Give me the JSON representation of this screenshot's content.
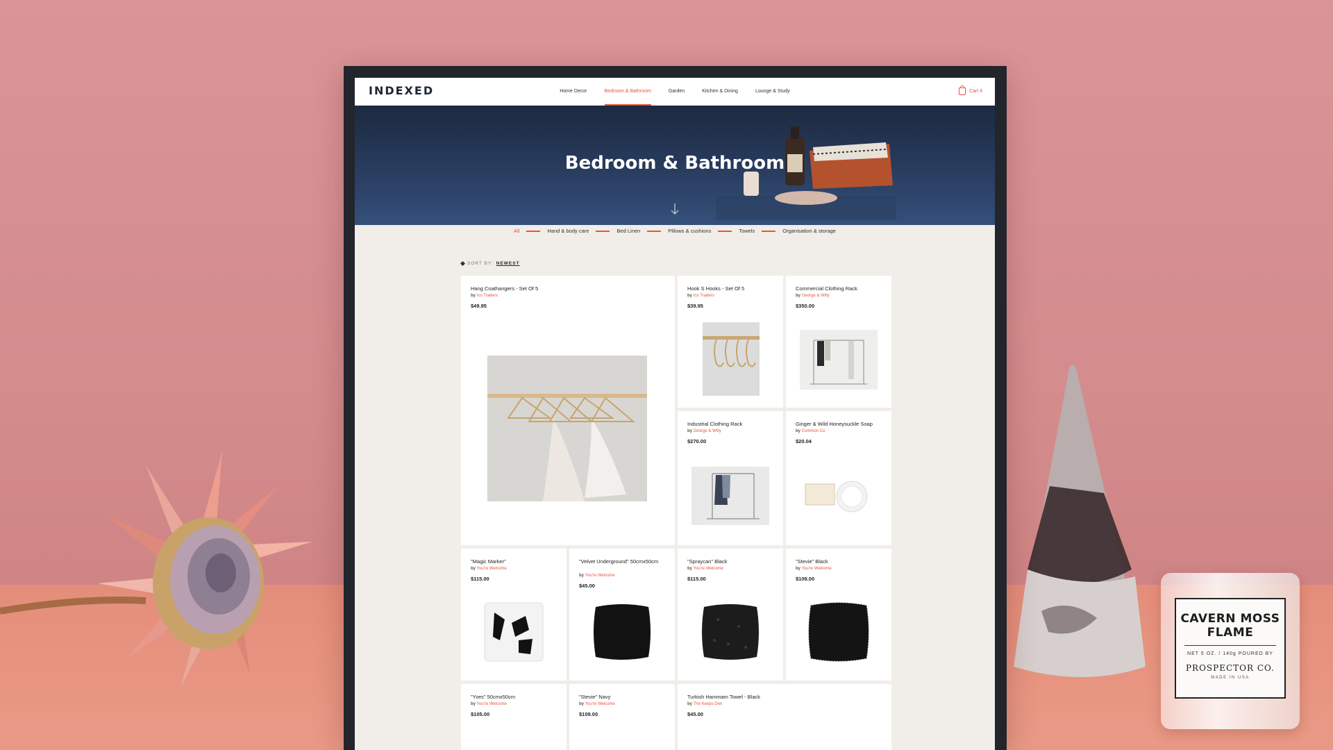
{
  "site": {
    "logo": "INDEXED",
    "nav": [
      "Home Decor",
      "Bedroom & Bathroom",
      "Garden",
      "Kitchen & Dining",
      "Lounge & Study"
    ],
    "active_nav": "Bedroom & Bathroom",
    "cart_label": "Cart 4"
  },
  "hero": {
    "title": "Bedroom & Bathroom"
  },
  "filters": [
    "All",
    "Hand & body care",
    "Bed Linen",
    "Pillows & cushions",
    "Towels",
    "Organisation & storage"
  ],
  "active_filter": "All",
  "sort": {
    "label": "SORT BY:",
    "value": "NEWEST"
  },
  "products": [
    {
      "name": "Hang Coathangers - Set Of 5",
      "by_prefix": "by",
      "brand": "Ico Traders",
      "price": "$49.95"
    },
    {
      "name": "Hook S Hooks - Set Of 5",
      "by_prefix": "by",
      "brand": "Ico Traders",
      "price": "$39.95"
    },
    {
      "name": "Commercial Clothing Rack",
      "by_prefix": "by",
      "brand": "George & Willy",
      "price": "$350.00"
    },
    {
      "name": "Industrial Clothing Rack",
      "by_prefix": "by",
      "brand": "George & Willy",
      "price": "$270.00"
    },
    {
      "name": "Ginger & Wild Honeysuckle Soap",
      "by_prefix": "by",
      "brand": "Common Co",
      "price": "$20.04"
    },
    {
      "name": "\"Magic Marker\"",
      "by_prefix": "by",
      "brand": "You're Welcome",
      "price": "$115.00"
    },
    {
      "name": "\"Velvet Underground\" 50cmx50cm",
      "by_prefix": "by",
      "brand": "You're Welcome",
      "price": "$45.00"
    },
    {
      "name": "\"Spraycan\" Black",
      "by_prefix": "by",
      "brand": "You're Welcome",
      "price": "$115.00"
    },
    {
      "name": "\"Stevie\" Black",
      "by_prefix": "by",
      "brand": "You're Welcome",
      "price": "$109.00"
    },
    {
      "name": "\"Yves\" 50cmx50cm",
      "by_prefix": "by",
      "brand": "You're Welcome",
      "price": "$105.00"
    },
    {
      "name": "\"Stevie\" Navy",
      "by_prefix": "by",
      "brand": "You're Welcome",
      "price": "$109.00"
    },
    {
      "name": "Turkish Hammam Towel - Black",
      "by_prefix": "by",
      "brand": "The Keeps Den",
      "price": "$45.00"
    }
  ],
  "candle": {
    "title": "CAVERN MOSS FLAME",
    "meta": "NET  5  OZ. / 140g    POURED BY",
    "brand": "PROSPECTOR CO.",
    "origin": "MADE IN USA"
  },
  "colors": {
    "accent": "#e8543c",
    "hero": "#27395a",
    "wall": "#d38a8b",
    "desk": "#e48e7a"
  }
}
